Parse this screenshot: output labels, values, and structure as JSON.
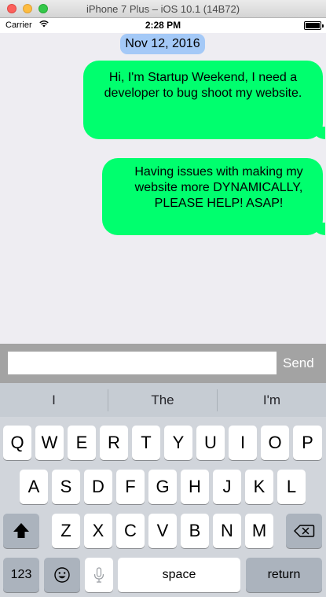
{
  "window": {
    "title": "iPhone 7 Plus – iOS 10.1 (14B72)"
  },
  "status_bar": {
    "carrier": "Carrier",
    "time": "2:28 PM"
  },
  "chat": {
    "date": "Nov 12, 2016",
    "messages": [
      "Hi, I'm Startup Weekend, I need a developer to bug shoot my website.",
      "Having issues with making my website more DYNAMICALLY, PLEASE HELP! ASAP!"
    ]
  },
  "input_bar": {
    "value": "",
    "placeholder": "",
    "send_label": "Send"
  },
  "keyboard": {
    "suggestions": [
      "I",
      "The",
      "I'm"
    ],
    "row1": [
      "Q",
      "W",
      "E",
      "R",
      "T",
      "Y",
      "U",
      "I",
      "O",
      "P"
    ],
    "row2": [
      "A",
      "S",
      "D",
      "F",
      "G",
      "H",
      "J",
      "K",
      "L"
    ],
    "row3": [
      "Z",
      "X",
      "C",
      "V",
      "B",
      "N",
      "M"
    ],
    "numbers_label": "123",
    "space_label": "space",
    "return_label": "return",
    "icons": [
      "shift-icon",
      "backspace-icon",
      "emoji-icon",
      "microphone-icon"
    ]
  },
  "colors": {
    "bubble": "#00ff6e",
    "date_pill": "#a4c9f7",
    "chat_background": "#eeedf2",
    "input_bar": "#a3a3a3"
  }
}
